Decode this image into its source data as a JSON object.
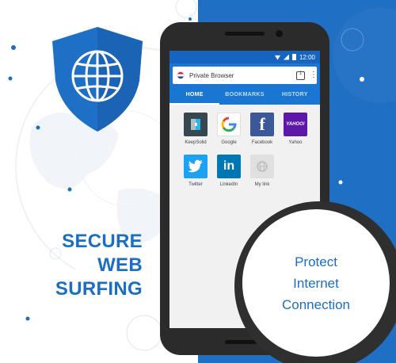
{
  "colors": {
    "brand_blue": "#1f6fc4",
    "app_bar": "#1976d2",
    "accent_text": "#1b6ec2"
  },
  "tagline": {
    "line1": "SECURE",
    "line2": "WEB",
    "line3": "SURFING"
  },
  "status_bar": {
    "time": "12:00"
  },
  "browser": {
    "title": "Private Browser",
    "tab_count": "1",
    "tabs": [
      {
        "label": "HOME",
        "active": true
      },
      {
        "label": "BOOKMARKS",
        "active": false
      },
      {
        "label": "HISTORY",
        "active": false
      }
    ],
    "speed_dial": [
      {
        "label": "KeepSolid",
        "icon": "keepsolid-icon"
      },
      {
        "label": "Google",
        "icon": "google-icon"
      },
      {
        "label": "Facebook",
        "icon": "facebook-icon",
        "glyph": "f"
      },
      {
        "label": "Yahoo",
        "icon": "yahoo-icon",
        "glyph": "YAHOO!"
      },
      {
        "label": "Twitter",
        "icon": "twitter-icon"
      },
      {
        "label": "LinkedIn",
        "icon": "linkedin-icon",
        "glyph": "in"
      },
      {
        "label": "My link",
        "icon": "mylink-icon"
      }
    ]
  },
  "callout": {
    "line1": "Protect",
    "line2": "Internet",
    "line3": "Connection"
  }
}
